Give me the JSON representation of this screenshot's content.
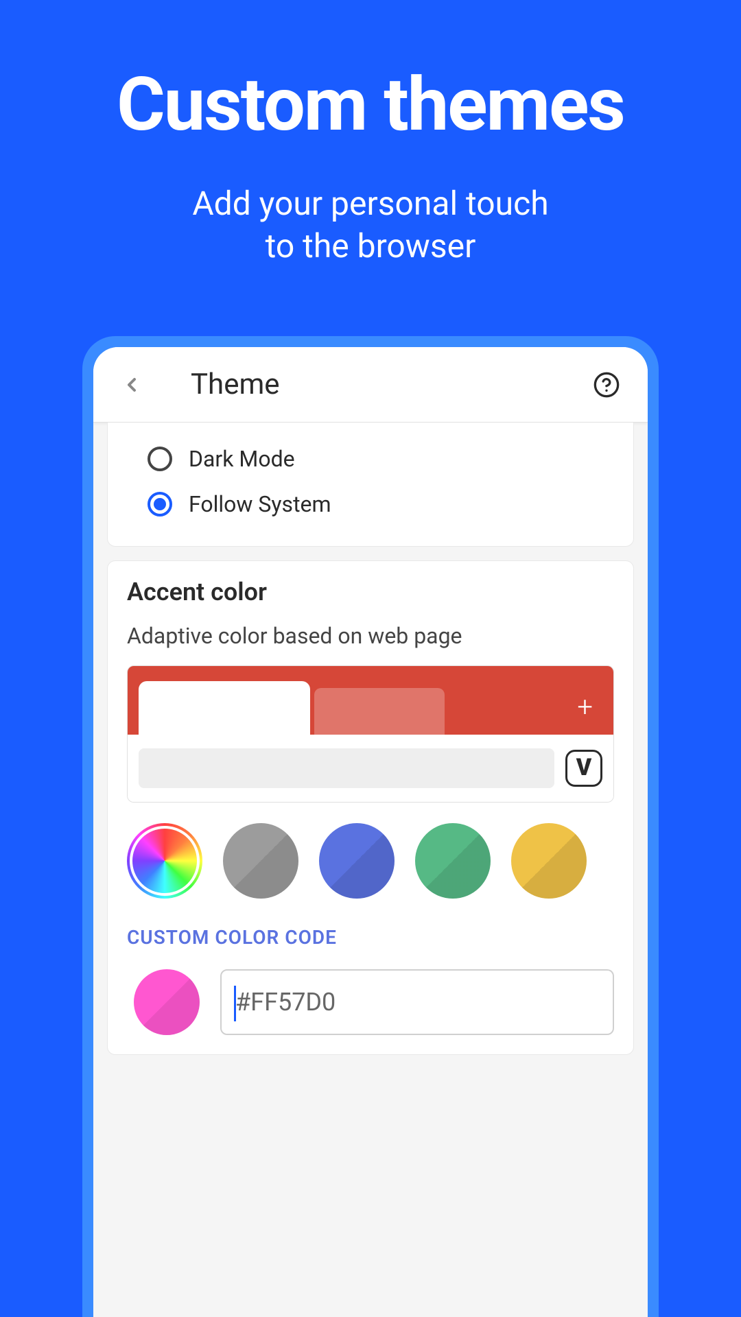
{
  "hero": {
    "title": "Custom themes",
    "subtitle_line1": "Add your personal touch",
    "subtitle_line2": "to the browser"
  },
  "header": {
    "title": "Theme"
  },
  "mode": {
    "options": [
      {
        "label": "Dark Mode",
        "selected": false
      },
      {
        "label": "Follow System",
        "selected": true
      }
    ]
  },
  "accent": {
    "title": "Accent color",
    "description": "Adaptive color based on web page",
    "preview_color": "#d64738",
    "swatches": [
      {
        "name": "rainbow",
        "color": "rainbow"
      },
      {
        "name": "gray",
        "color": "#9c9c9c"
      },
      {
        "name": "blue",
        "color": "#5a72e0"
      },
      {
        "name": "green",
        "color": "#56b985"
      },
      {
        "name": "yellow",
        "color": "#efc247"
      }
    ],
    "custom_label": "CUSTOM COLOR CODE",
    "custom_value": "#FF57D0",
    "custom_swatch_color": "#ff57d0"
  }
}
